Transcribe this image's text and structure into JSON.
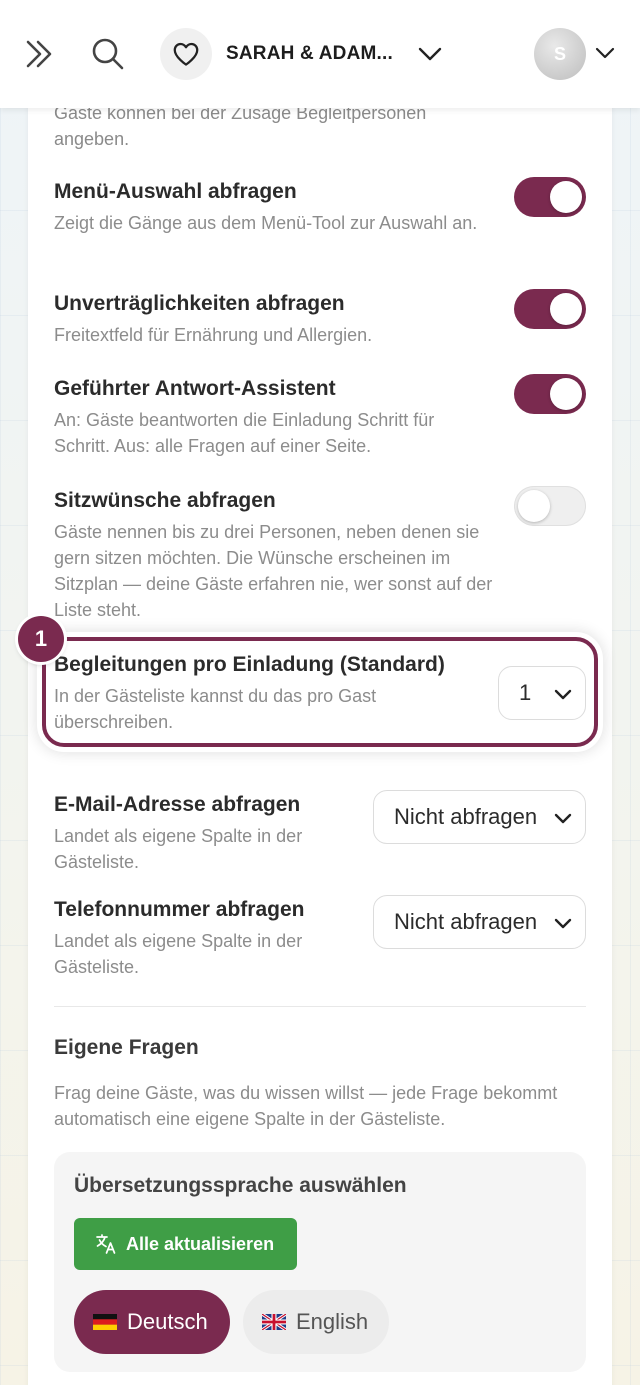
{
  "header": {
    "event_name": "SARAH & ADAM...",
    "avatar_initial": "S"
  },
  "intro_text": "Gäste können bei der Zusage Begleitpersonen angeben.",
  "settings": [
    {
      "title": "Menü-Auswahl abfragen",
      "desc": "Zeigt die Gänge aus dem Menü-Tool zur Auswahl an.",
      "enabled": true
    },
    {
      "title": "Unverträglichkeiten abfragen",
      "desc": "Freitextfeld für Ernährung und Allergien.",
      "enabled": true
    },
    {
      "title": "Geführter Antwort-Assistent",
      "desc": "An: Gäste beantworten die Einladung Schritt für Schritt. Aus: alle Fragen auf einer Seite.",
      "enabled": true
    },
    {
      "title": "Sitzwünsche abfragen",
      "desc": "Gäste nennen bis zu drei Personen, neben denen sie gern sitzen möchten. Die Wünsche erscheinen im Sitzplan — deine Gäste erfahren nie, wer sonst auf der Liste steht.",
      "enabled": false
    }
  ],
  "companions": {
    "step_number": "1",
    "title": "Begleitungen pro Einladung (Standard)",
    "desc": "In der Gästeliste kannst du das pro Gast überschreiben.",
    "value": "1"
  },
  "email_field": {
    "title": "E-Mail-Adresse abfragen",
    "desc": "Landet als eigene Spalte in der Gästeliste.",
    "value": "Nicht abfragen"
  },
  "phone_field": {
    "title": "Telefonnummer abfragen",
    "desc": "Landet als eigene Spalte in der Gästeliste.",
    "value": "Nicht abfragen"
  },
  "custom_questions": {
    "title": "Eigene Fragen",
    "desc": "Frag deine Gäste, was du wissen willst — jede Frage bekommt automatisch eine eigene Spalte in der Gästeliste."
  },
  "translation": {
    "title": "Übersetzungssprache auswählen",
    "update_all_label": "Alle aktualisieren",
    "languages": [
      {
        "label": "Deutsch",
        "active": true
      },
      {
        "label": "English",
        "active": false
      }
    ]
  },
  "colors": {
    "accent": "#7a2a4f",
    "success": "#3f9e46"
  },
  "icons": [
    "expand-icon",
    "search-icon",
    "heart-icon",
    "chevron-down-icon",
    "translate-icon",
    "flag-de-icon",
    "flag-uk-icon"
  ]
}
